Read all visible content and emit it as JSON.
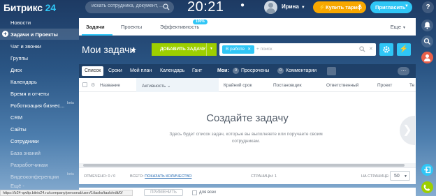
{
  "header": {
    "logo_name": "Битрикс",
    "logo_num": "24",
    "search_placeholder": "искать сотрудника, документ, ...",
    "clock": "20:21",
    "user_name": "Ирина",
    "buy_label": "Купить тариф",
    "invite_label": "Пригласить",
    "help_label": "?"
  },
  "sidebar": {
    "items": [
      {
        "label": "Новости"
      },
      {
        "label": "Задачи и Проекты"
      },
      {
        "label": "Чат и звонки"
      },
      {
        "label": "Группы"
      },
      {
        "label": "Диск"
      },
      {
        "label": "Календарь"
      },
      {
        "label": "Время и отчеты"
      },
      {
        "label": "Роботизация бизнес...",
        "beta": "beta"
      },
      {
        "label": "CRM"
      },
      {
        "label": "Сайты"
      },
      {
        "label": "Сотрудники"
      },
      {
        "label": "База знаний"
      },
      {
        "label": "Разработчикам"
      },
      {
        "label": "Видеоконференции",
        "beta": "beta"
      }
    ],
    "more_label": "Ещё -"
  },
  "tabs": {
    "items": [
      "Задачи",
      "Проекты",
      "Эффективность"
    ],
    "badge": "100%",
    "more": "Еще"
  },
  "toolbar": {
    "title": "Мои задачи",
    "add_label": "ДОБАВИТЬ ЗАДАЧУ",
    "filter_tag": "В работе",
    "filter_placeholder": "+ поиск"
  },
  "views": {
    "items": [
      "Список",
      "Сроки",
      "Мой план",
      "Календарь",
      "Гант"
    ],
    "my_label": "Мои:",
    "chips": [
      {
        "count": "0",
        "label": "Просрочены"
      },
      {
        "count": "0",
        "label": "Комментарии"
      }
    ]
  },
  "grid": {
    "columns": [
      "Название",
      "Активность",
      "Крайний срок",
      "Постановщик",
      "Ответственный",
      "Проект",
      "Те"
    ],
    "sort_arrow": "⌄",
    "empty_title": "Создайте задачу",
    "empty_text": "Здесь будет список задач, которые вы выполняете или поручаете своим сотрудникам."
  },
  "footer": {
    "selected": "ОТМЕЧЕНО: 0 / 0",
    "total_prefix": "ВСЕГО:",
    "total_link": "ПОКАЗАТЬ КОЛИЧЕСТВО",
    "pages": "СТРАНИЦЫ: 1",
    "per_page_label": "НА СТРАНИЦЕ:",
    "per_page_value": "50"
  },
  "actions": {
    "apply_label": "ПРИМЕНИТЬ",
    "for_all_label": "для всех"
  },
  "status_url": "https://b24-qwlip.bitrix24.ru/company/personal/user/1/tasks/task/edit/0/",
  "colors": {
    "accent_blue": "#2fc6f6",
    "add_green": "#9dcf00",
    "buy_orange": "#f7a700"
  }
}
